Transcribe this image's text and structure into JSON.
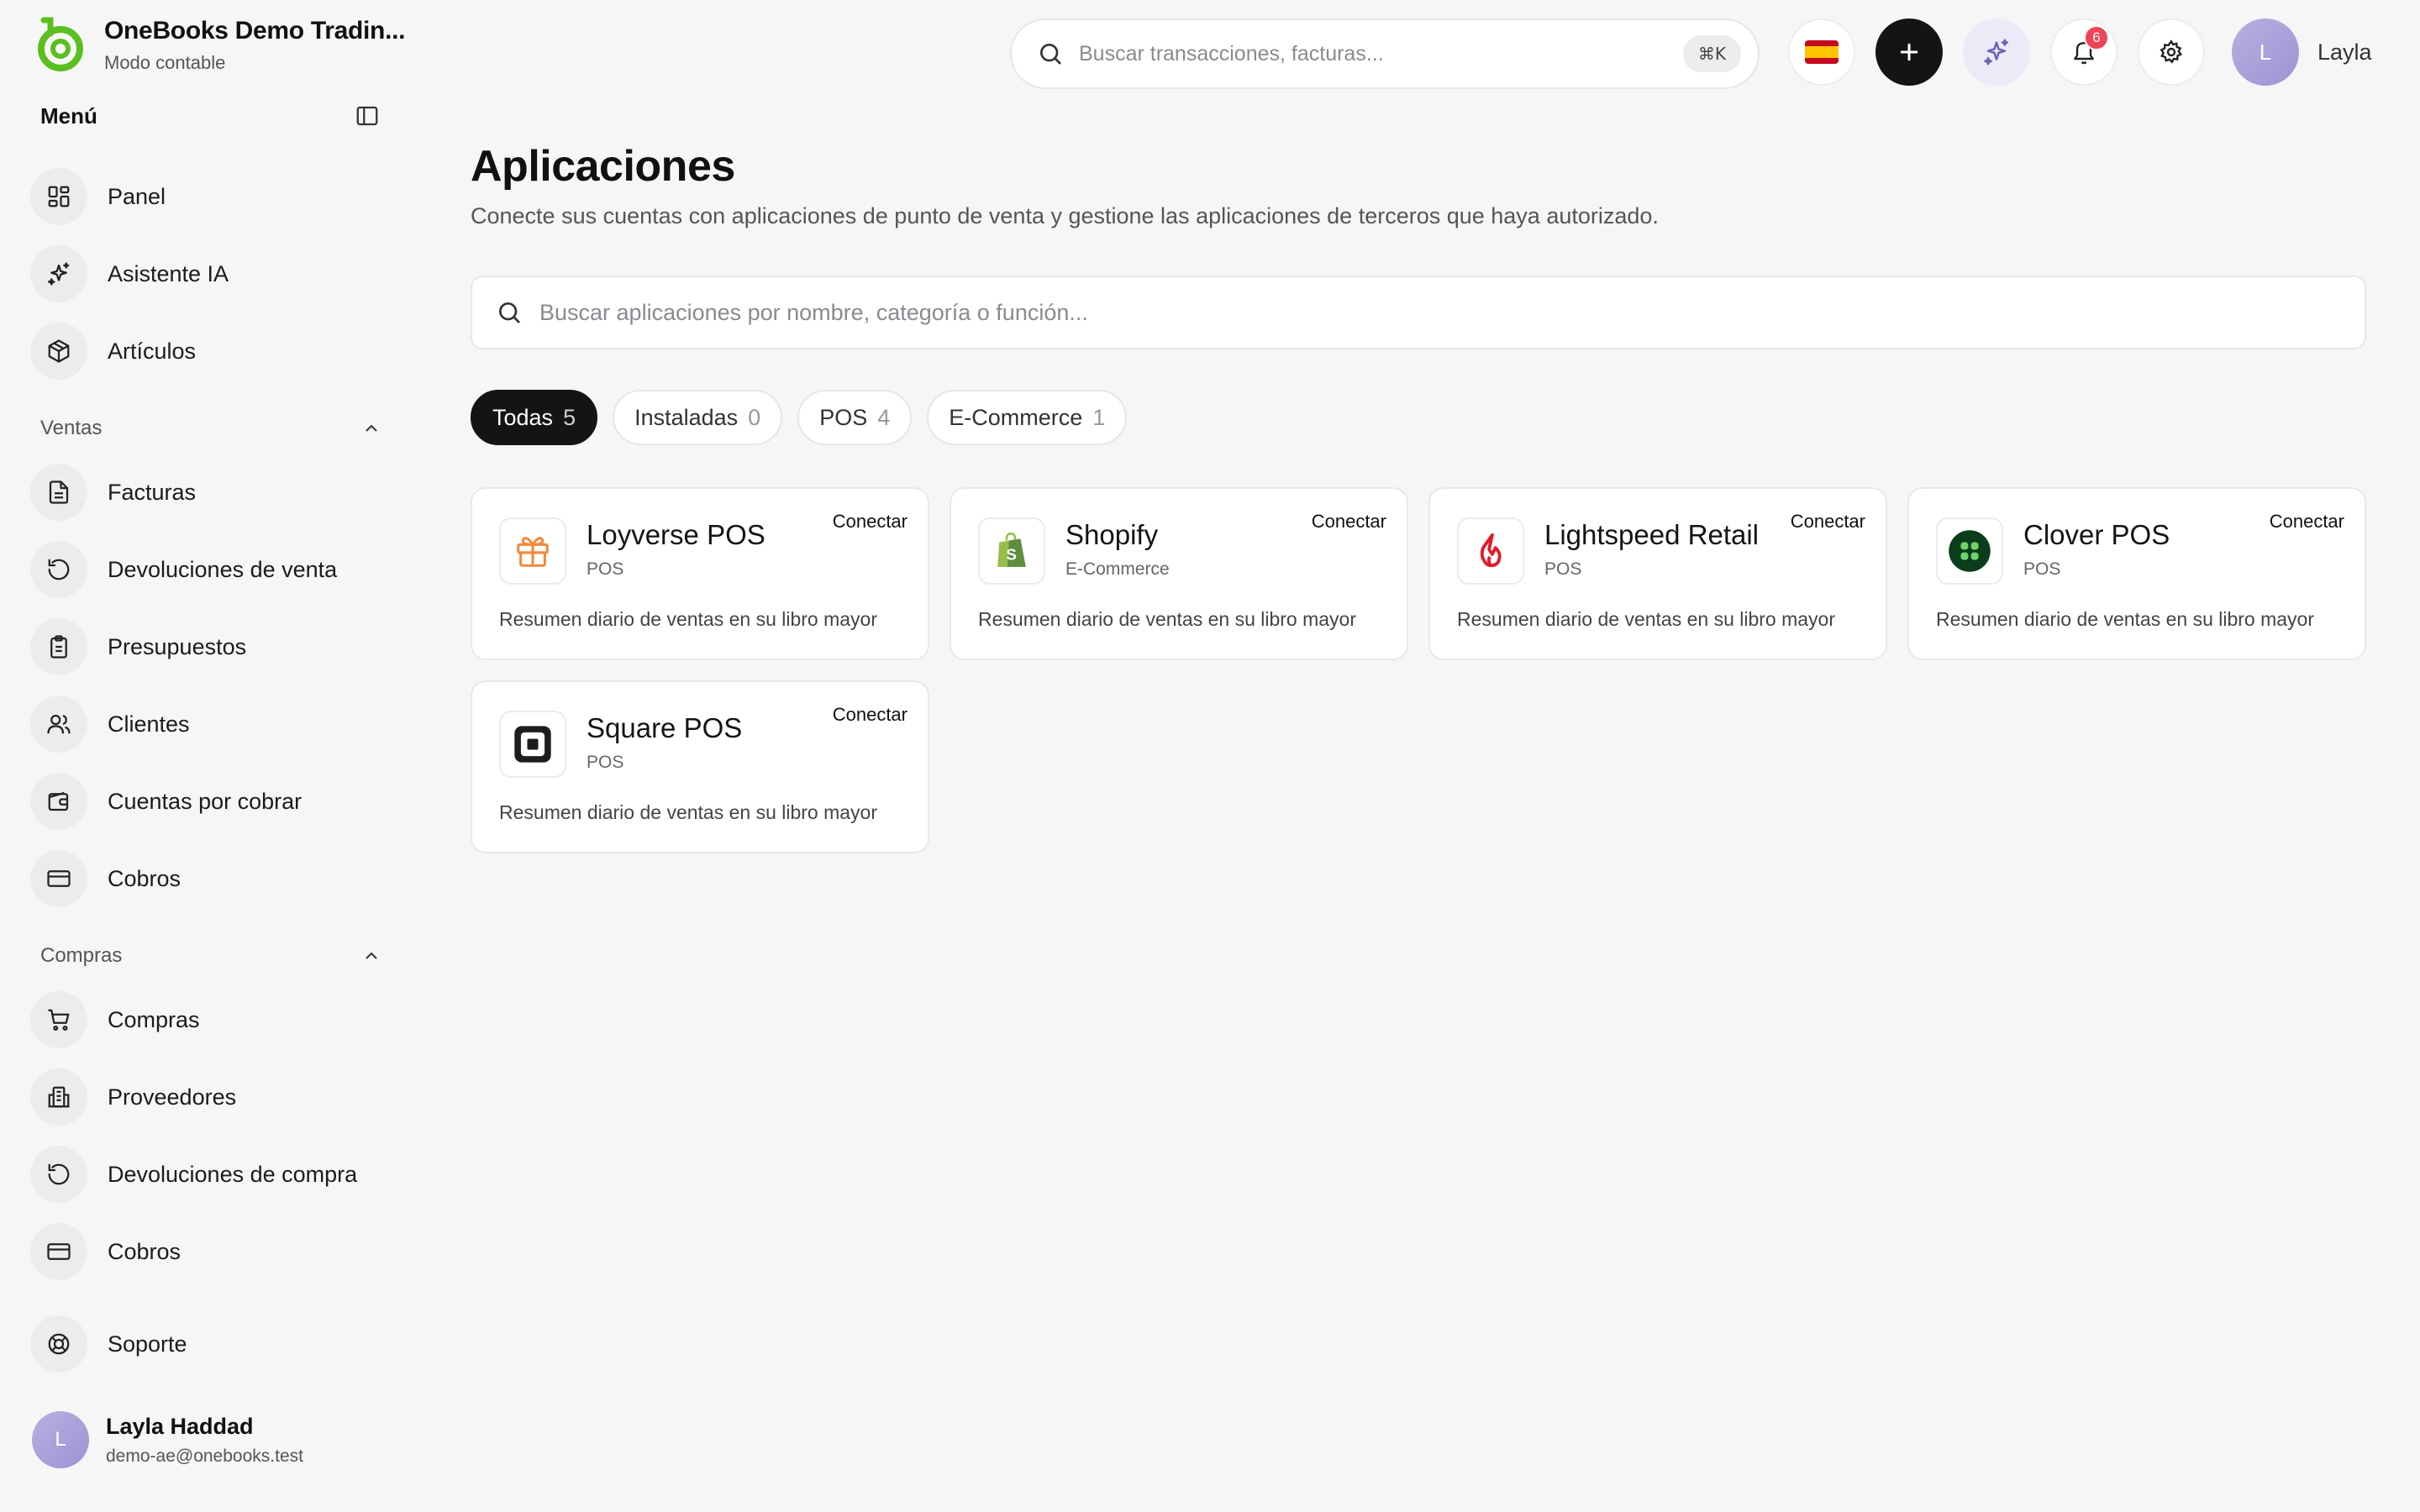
{
  "brand": {
    "name": "OneBooks Demo Tradin...",
    "subtitle": "Modo contable"
  },
  "sidebar": {
    "menu_title": "Menú",
    "top_items": [
      {
        "label": "Panel",
        "icon": "dashboard-icon"
      },
      {
        "label": "Asistente IA",
        "icon": "sparkles-icon"
      },
      {
        "label": "Artículos",
        "icon": "package-icon"
      }
    ],
    "sections": [
      {
        "title": "Ventas",
        "items": [
          {
            "label": "Facturas",
            "icon": "file-text-icon"
          },
          {
            "label": "Devoluciones de venta",
            "icon": "rotate-ccw-icon"
          },
          {
            "label": "Presupuestos",
            "icon": "clipboard-icon"
          },
          {
            "label": "Clientes",
            "icon": "users-icon"
          },
          {
            "label": "Cuentas por cobrar",
            "icon": "wallet-icon"
          },
          {
            "label": "Cobros",
            "icon": "credit-card-icon"
          }
        ]
      },
      {
        "title": "Compras",
        "items": [
          {
            "label": "Compras",
            "icon": "shopping-cart-icon"
          },
          {
            "label": "Proveedores",
            "icon": "building-icon"
          },
          {
            "label": "Devoluciones de compra",
            "icon": "rotate-ccw-icon"
          },
          {
            "label": "Cobros",
            "icon": "credit-card-icon"
          }
        ]
      }
    ],
    "support": {
      "label": "Soporte",
      "icon": "life-buoy-icon"
    },
    "user": {
      "initial": "L",
      "name": "Layla Haddad",
      "email": "demo-ae@onebooks.test"
    }
  },
  "header": {
    "search_placeholder": "Buscar transacciones, facturas...",
    "shortcut": "⌘K",
    "notifications_count": "6",
    "user_initial": "L",
    "user_name": "Layla"
  },
  "main": {
    "title": "Aplicaciones",
    "subtitle": "Conecte sus cuentas con aplicaciones de punto de venta y gestione las aplicaciones de terceros que haya autorizado.",
    "search_placeholder": "Buscar aplicaciones por nombre, categoría o función...",
    "filters": [
      {
        "label": "Todas",
        "count": "5",
        "active": true
      },
      {
        "label": "Instaladas",
        "count": "0",
        "active": false
      },
      {
        "label": "POS",
        "count": "4",
        "active": false
      },
      {
        "label": "E-Commerce",
        "count": "1",
        "active": false
      }
    ],
    "apps": [
      {
        "name": "Loyverse POS",
        "category": "POS",
        "description": "Resumen diario de ventas en su libro mayor",
        "action": "Conectar",
        "logo": "loyverse-logo-icon"
      },
      {
        "name": "Shopify",
        "category": "E-Commerce",
        "description": "Resumen diario de ventas en su libro mayor",
        "action": "Conectar",
        "logo": "shopify-logo-icon"
      },
      {
        "name": "Lightspeed Retail",
        "category": "POS",
        "description": "Resumen diario de ventas en su libro mayor",
        "action": "Conectar",
        "logo": "lightspeed-logo-icon"
      },
      {
        "name": "Clover POS",
        "category": "POS",
        "description": "Resumen diario de ventas en su libro mayor",
        "action": "Conectar",
        "logo": "clover-logo-icon"
      },
      {
        "name": "Square POS",
        "category": "POS",
        "description": "Resumen diario de ventas en su libro mayor",
        "action": "Conectar",
        "logo": "square-logo-icon"
      }
    ]
  },
  "colors": {
    "brand_green": "#5bbf1f",
    "dark": "#141416",
    "badge": "#ef4358",
    "avatar": "#a9a2da"
  }
}
